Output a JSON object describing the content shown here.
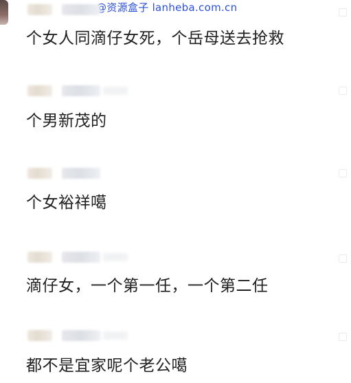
{
  "watermark": "@资源盒子 lanheba.com.cn",
  "comments": [
    {
      "text": "个女人同滴仔女死，个岳母送去抢救"
    },
    {
      "text": "个男新茂的"
    },
    {
      "text": "个女裕祥噶"
    },
    {
      "text": "滴仔女，一个第一任，一个第二任"
    },
    {
      "text": "都不是宜家呢个老公噶"
    }
  ]
}
